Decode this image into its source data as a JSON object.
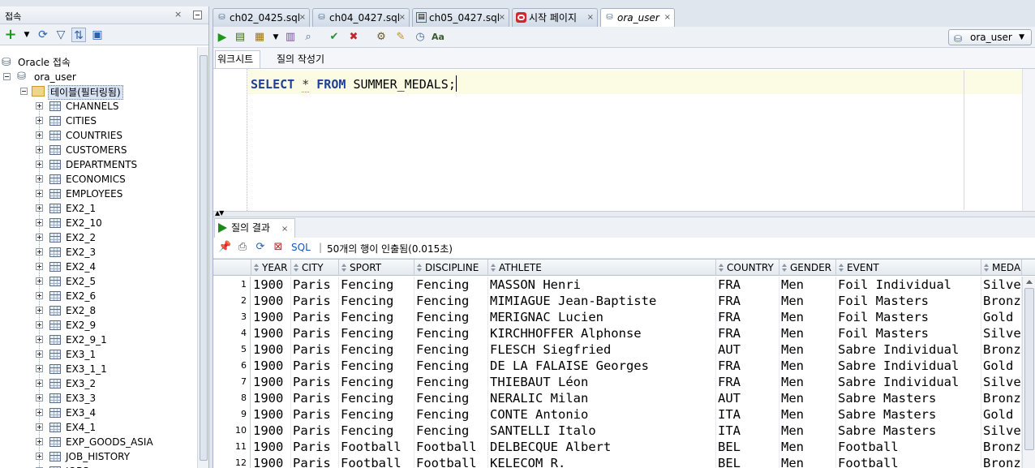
{
  "left_panel": {
    "title": "접속",
    "close": "×",
    "root": "Oracle 접속",
    "connection": "ora_user",
    "tables_folder": "테이블(필터링됨)",
    "tables": [
      "CHANNELS",
      "CITIES",
      "COUNTRIES",
      "CUSTOMERS",
      "DEPARTMENTS",
      "ECONOMICS",
      "EMPLOYEES",
      "EX2_1",
      "EX2_10",
      "EX2_2",
      "EX2_3",
      "EX2_4",
      "EX2_5",
      "EX2_6",
      "EX2_8",
      "EX2_9",
      "EX2_9_1",
      "EX3_1",
      "EX3_1_1",
      "EX3_2",
      "EX3_3",
      "EX3_4",
      "EX4_1",
      "EXP_GOODS_ASIA",
      "JOB_HISTORY",
      "JOBS"
    ]
  },
  "tabs": [
    {
      "label": "ch02_0425.sql",
      "icon": "sql-file-icon",
      "close": "×"
    },
    {
      "label": "ch04_0427.sql",
      "icon": "sql-file-icon",
      "close": "×"
    },
    {
      "label": "ch05_0427.sql",
      "icon": "sql-file-icon",
      "close": "×"
    },
    {
      "label": "시작 페이지",
      "icon": "oracle-icon",
      "close": "×"
    },
    {
      "label": "ora_user",
      "icon": "database-icon",
      "close": "×"
    }
  ],
  "connection_select": {
    "value": "ora_user"
  },
  "subtabs": [
    "워크시트",
    "질의 작성기"
  ],
  "sql": {
    "kw1": "SELECT",
    "star": "*",
    "kw2": "FROM",
    "rest": "SUMMER_MEDALS;"
  },
  "results": {
    "tab_label": "질의 결과",
    "tab_close": "×",
    "sql_link": "SQL",
    "separator": "|",
    "status": "50개의 행이 인출됨(0.015초)"
  },
  "grid": {
    "columns": [
      "YEAR",
      "CITY",
      "SPORT",
      "DISCIPLINE",
      "ATHLETE",
      "COUNTRY",
      "GENDER",
      "EVENT",
      "MEDAL"
    ],
    "rows": [
      [
        "1",
        "1900",
        "Paris",
        "Fencing",
        "Fencing",
        "MASSON Henri",
        "FRA",
        "Men",
        "Foil Individual",
        "Silver"
      ],
      [
        "2",
        "1900",
        "Paris",
        "Fencing",
        "Fencing",
        "MIMIAGUE Jean-Baptiste",
        "FRA",
        "Men",
        "Foil Masters",
        "Bronze"
      ],
      [
        "3",
        "1900",
        "Paris",
        "Fencing",
        "Fencing",
        "MERIGNAC Lucien",
        "FRA",
        "Men",
        "Foil Masters",
        "Gold"
      ],
      [
        "4",
        "1900",
        "Paris",
        "Fencing",
        "Fencing",
        "KIRCHHOFFER Alphonse",
        "FRA",
        "Men",
        "Foil Masters",
        "Silver"
      ],
      [
        "5",
        "1900",
        "Paris",
        "Fencing",
        "Fencing",
        "FLESCH Siegfried",
        "AUT",
        "Men",
        "Sabre Individual",
        "Bronze"
      ],
      [
        "6",
        "1900",
        "Paris",
        "Fencing",
        "Fencing",
        "DE LA FALAISE Georges",
        "FRA",
        "Men",
        "Sabre Individual",
        "Gold"
      ],
      [
        "7",
        "1900",
        "Paris",
        "Fencing",
        "Fencing",
        "THIEBAUT Léon",
        "FRA",
        "Men",
        "Sabre Individual",
        "Silver"
      ],
      [
        "8",
        "1900",
        "Paris",
        "Fencing",
        "Fencing",
        "NERALIC Milan",
        "AUT",
        "Men",
        "Sabre Masters",
        "Bronze"
      ],
      [
        "9",
        "1900",
        "Paris",
        "Fencing",
        "Fencing",
        "CONTE Antonio",
        "ITA",
        "Men",
        "Sabre Masters",
        "Gold"
      ],
      [
        "10",
        "1900",
        "Paris",
        "Fencing",
        "Fencing",
        "SANTELLI Italo",
        "ITA",
        "Men",
        "Sabre Masters",
        "Silver"
      ],
      [
        "11",
        "1900",
        "Paris",
        "Football",
        "Football",
        "DELBECQUE Albert",
        "BEL",
        "Men",
        "Football",
        "Bronze"
      ],
      [
        "12",
        "1900",
        "Paris",
        "Football",
        "Football",
        "KELECOM R.",
        "BEL",
        "Men",
        "Football",
        "Bronze"
      ]
    ]
  }
}
